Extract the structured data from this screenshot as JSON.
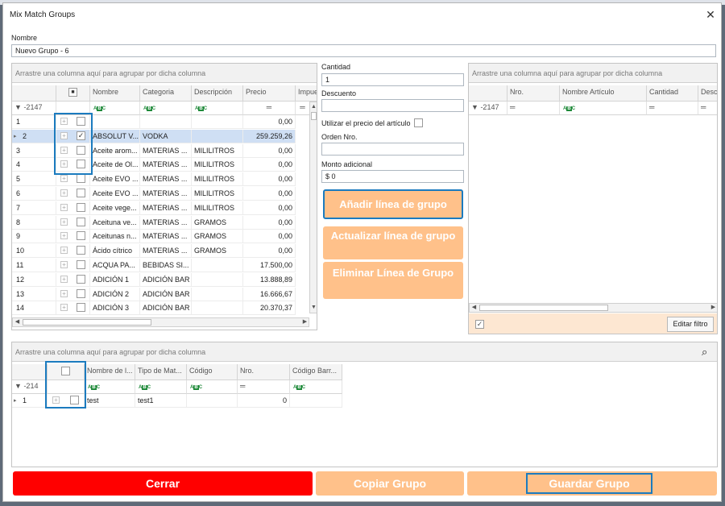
{
  "window": {
    "title": "Mix Match Groups",
    "close": "✕"
  },
  "nombre": {
    "label": "Nombre",
    "value": "Nuevo Grupo - 6"
  },
  "left_grid": {
    "group_hint": "Arrastre una columna aquí para agrupar por dicha columna",
    "columns": [
      "Nombre",
      "Categoria",
      "Descripción",
      "Precio",
      "Impue"
    ],
    "filter_id": "-2147",
    "rows": [
      {
        "id": "1",
        "nombre": "",
        "categoria": "",
        "descripcion": "",
        "precio": "0,00",
        "checked": false
      },
      {
        "id": "2",
        "nombre": "ABSOLUT V...",
        "categoria": "VODKA",
        "descripcion": "",
        "precio": "259.259,26",
        "checked": true
      },
      {
        "id": "3",
        "nombre": "Aceite arom...",
        "categoria": "MATERIAS ...",
        "descripcion": "MILILITROS",
        "precio": "0,00",
        "checked": false
      },
      {
        "id": "4",
        "nombre": "Aceite de Ol...",
        "categoria": "MATERIAS ...",
        "descripcion": "MILILITROS",
        "precio": "0,00",
        "checked": false
      },
      {
        "id": "5",
        "nombre": "Aceite EVO ...",
        "categoria": "MATERIAS ...",
        "descripcion": "MILILITROS",
        "precio": "0,00",
        "checked": false
      },
      {
        "id": "6",
        "nombre": "Aceite EVO ...",
        "categoria": "MATERIAS ...",
        "descripcion": "MILILITROS",
        "precio": "0,00",
        "checked": false
      },
      {
        "id": "7",
        "nombre": "Aceite vege...",
        "categoria": "MATERIAS ...",
        "descripcion": "MILILITROS",
        "precio": "0,00",
        "checked": false
      },
      {
        "id": "8",
        "nombre": "Aceituna ve...",
        "categoria": "MATERIAS ...",
        "descripcion": "GRAMOS",
        "precio": "0,00",
        "checked": false
      },
      {
        "id": "9",
        "nombre": "Aceitunas n...",
        "categoria": "MATERIAS ...",
        "descripcion": "GRAMOS",
        "precio": "0,00",
        "checked": false
      },
      {
        "id": "10",
        "nombre": "Ácido cítrico",
        "categoria": "MATERIAS ...",
        "descripcion": "GRAMOS",
        "precio": "0,00",
        "checked": false
      },
      {
        "id": "11",
        "nombre": "ACQUA PA...",
        "categoria": "BEBIDAS SI...",
        "descripcion": "",
        "precio": "17.500,00",
        "checked": false
      },
      {
        "id": "12",
        "nombre": "ADICIÓN 1",
        "categoria": "ADICIÓN BAR",
        "descripcion": "",
        "precio": "13.888,89",
        "checked": false
      },
      {
        "id": "13",
        "nombre": "ADICIÓN 2",
        "categoria": "ADICIÓN BAR",
        "descripcion": "",
        "precio": "16.666,67",
        "checked": false
      },
      {
        "id": "14",
        "nombre": "ADICIÓN 3",
        "categoria": "ADICIÓN BAR",
        "descripcion": "",
        "precio": "20.370,37",
        "checked": false
      }
    ]
  },
  "middle": {
    "cantidad_label": "Cantidad",
    "cantidad_value": "1",
    "descuento_label": "Descuento",
    "descuento_value": "",
    "utilizar_label": "Utilizar el precio del artículo",
    "orden_label": "Orden Nro.",
    "orden_value": "",
    "monto_label": "Monto adicional",
    "monto_value": "$ 0",
    "anadir": "Añadir línea de grupo",
    "actualizar": "Actualizar línea de grupo",
    "eliminar": "Eliminar Línea de Grupo"
  },
  "right_grid": {
    "group_hint": "Arrastre una columna aquí para agrupar por dicha columna",
    "columns": [
      "Nro.",
      "Nombre Artículo",
      "Cantidad",
      "Desc"
    ],
    "filter_id": "-2147",
    "editar_filtro": "Editar filtro"
  },
  "bottom_grid": {
    "group_hint": "Arrastre una columna aquí para agrupar por dicha columna",
    "columns": [
      "Nombre de l...",
      "Tipo de Mat...",
      "Código",
      "Nro.",
      "Código Barr..."
    ],
    "filter_id": "-214",
    "rows": [
      {
        "id": "1",
        "nombre": "test",
        "tipo": "test1",
        "codigo": "",
        "nro": "0",
        "codigo_barras": ""
      }
    ]
  },
  "footer": {
    "cerrar": "Cerrar",
    "copiar": "Copiar Grupo",
    "guardar": "Guardar Grupo"
  },
  "colors": {
    "accent_orange": "#ffc18a",
    "close_red": "#ff0000",
    "frame_blue": "#1b7bbf",
    "row_selected": "#cfdff4"
  },
  "icons": {
    "filter": "filter-icon",
    "search": "search-icon",
    "expand": "expand-plus-icon"
  }
}
